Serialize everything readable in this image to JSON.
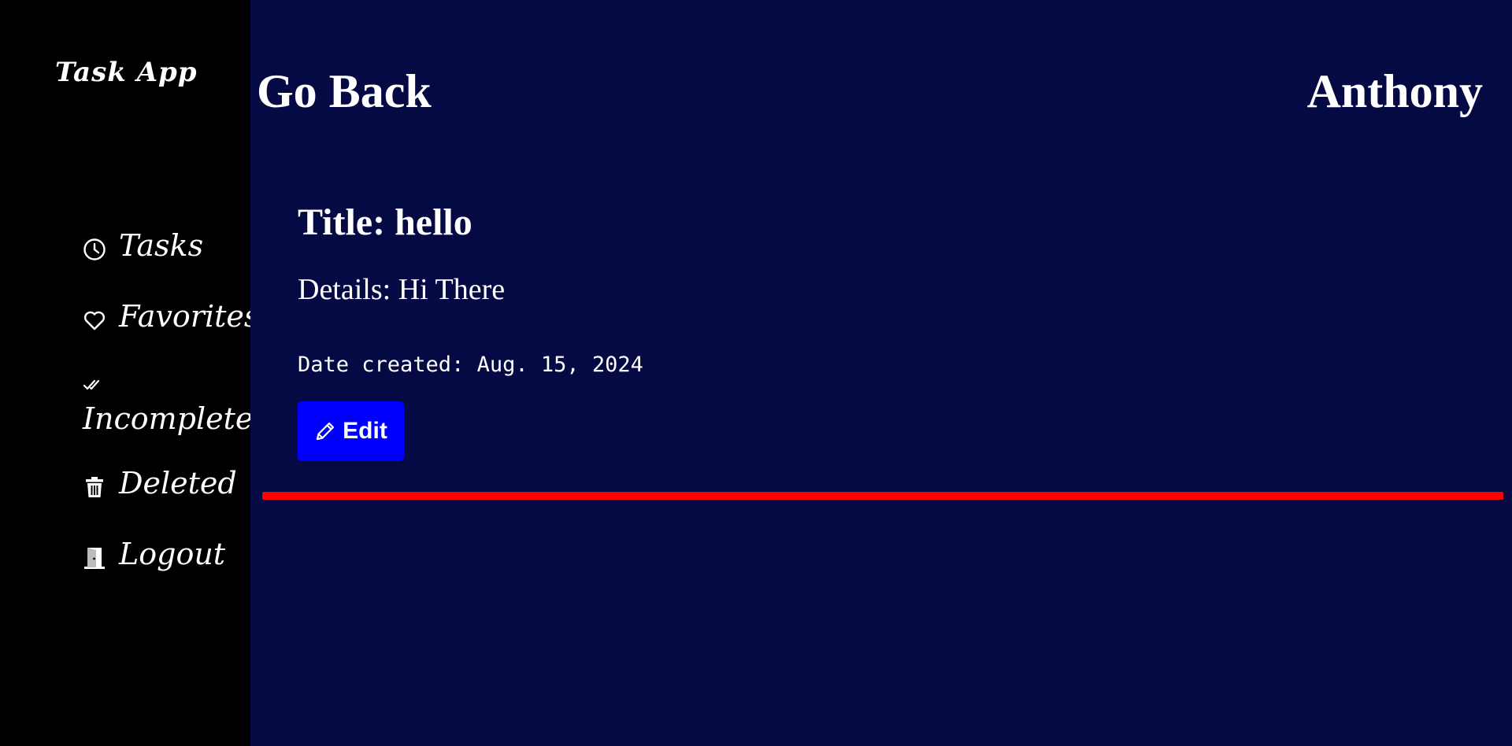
{
  "sidebar": {
    "brand": "Task App",
    "items": [
      {
        "label": "Tasks",
        "icon": "clock-icon"
      },
      {
        "label": "Favorites",
        "icon": "heart-icon"
      },
      {
        "label": "Incomplete",
        "icon": "double-check-icon"
      },
      {
        "label": "Deleted",
        "icon": "trash-icon"
      },
      {
        "label": "Logout",
        "icon": "door-icon"
      }
    ]
  },
  "header": {
    "back_label": "Go Back",
    "user_name": "Anthony"
  },
  "task": {
    "title": "Title: hello",
    "details": "Details: Hi There",
    "date_created": "Date created: Aug. 15, 2024",
    "edit_label": "Edit",
    "edit_icon": "pencil-icon"
  },
  "colors": {
    "sidebar_bg": "#000000",
    "main_bg": "#050a44",
    "accent_button": "#0000ff",
    "divider": "#ff0000",
    "text": "#ffffff"
  }
}
